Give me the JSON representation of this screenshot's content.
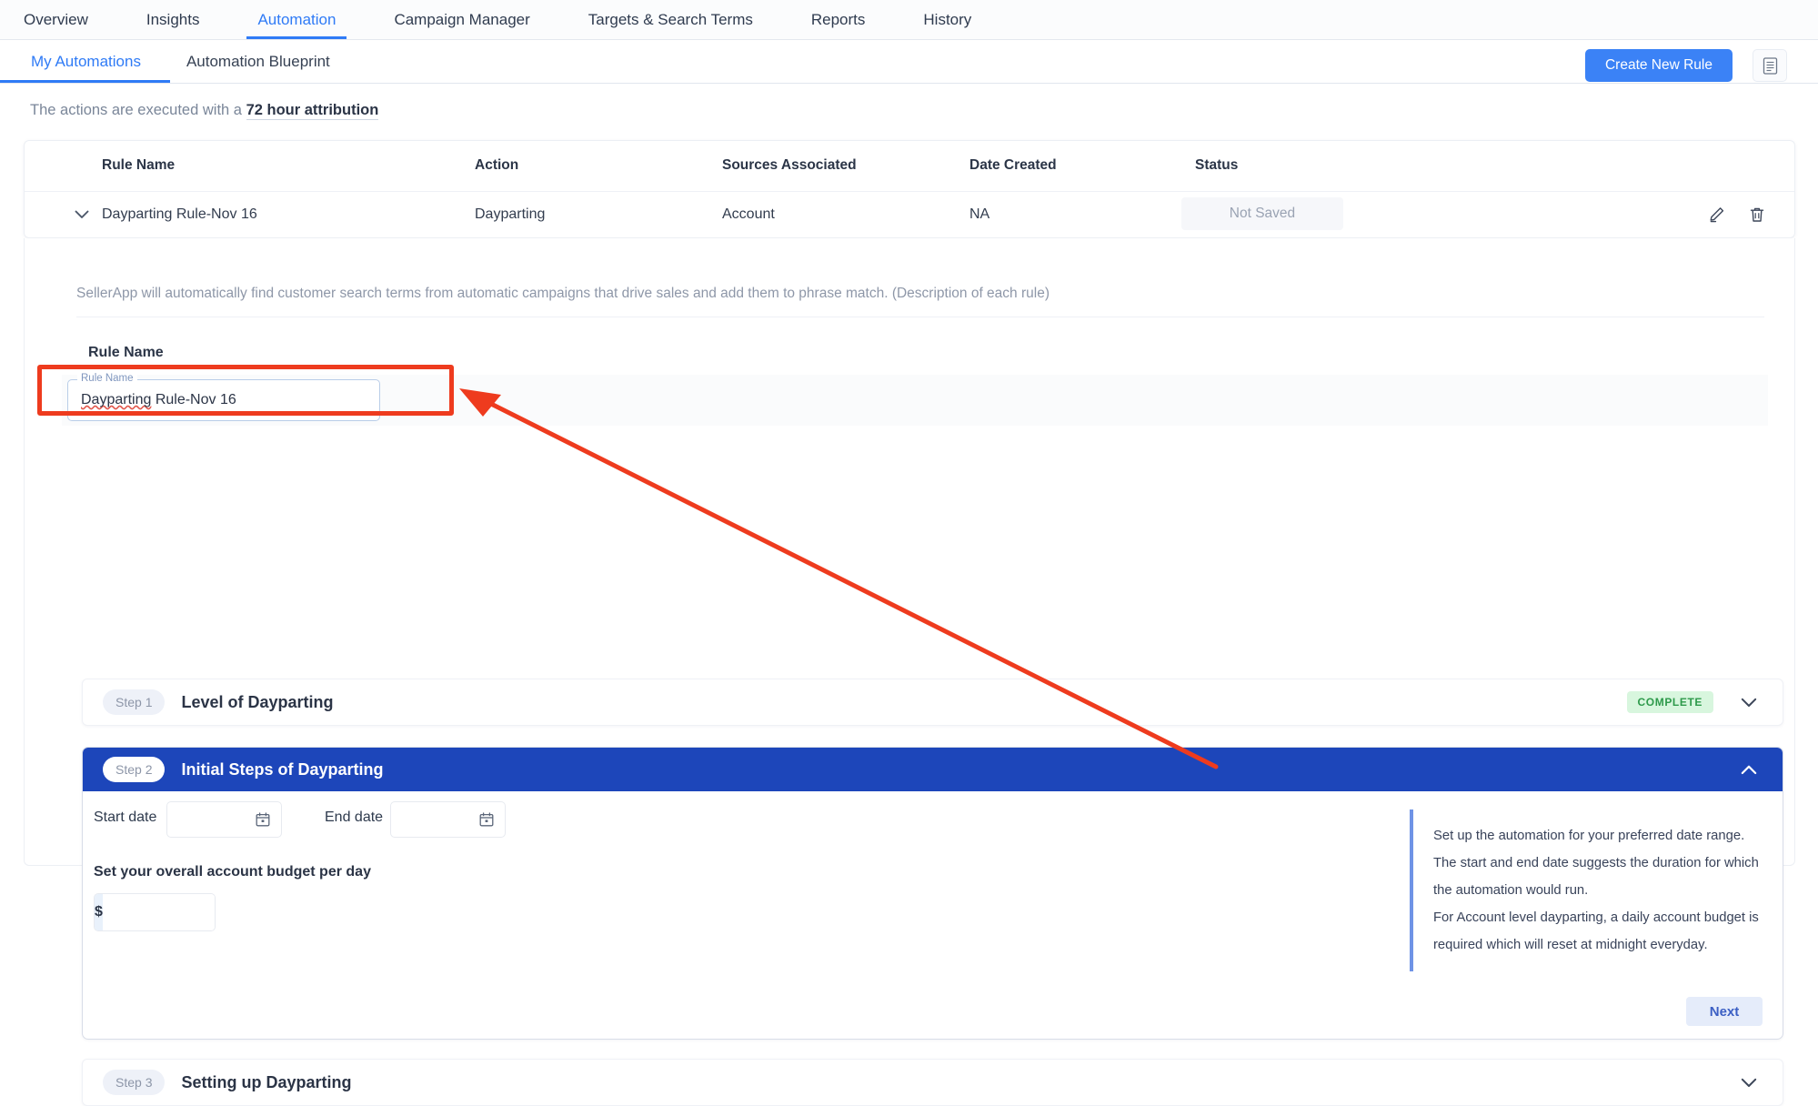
{
  "topnav": {
    "items": [
      {
        "label": "Overview",
        "active": false
      },
      {
        "label": "Insights",
        "active": false
      },
      {
        "label": "Automation",
        "active": true
      },
      {
        "label": "Campaign Manager",
        "active": false
      },
      {
        "label": "Targets & Search Terms",
        "active": false
      },
      {
        "label": "Reports",
        "active": false
      },
      {
        "label": "History",
        "active": false
      }
    ]
  },
  "subnav": {
    "items": [
      {
        "label": "My Automations",
        "active": true
      },
      {
        "label": "Automation Blueprint",
        "active": false
      }
    ],
    "create_button": "Create New Rule",
    "doc_icon": "document-icon"
  },
  "attribution": {
    "prefix": "The actions are executed with a ",
    "highlight": "72 hour attribution"
  },
  "table": {
    "headers": [
      "Rule Name",
      "Action",
      "Sources Associated",
      "Date Created",
      "Status"
    ],
    "rows": [
      {
        "rule_name": "Dayparting Rule-Nov 16",
        "action": "Dayparting",
        "sources": "Account",
        "date_created": "NA",
        "status": "Not Saved",
        "expanded": true
      }
    ]
  },
  "detail": {
    "description": "SellerApp will automatically find customer search terms from automatic campaigns that drive sales and add them to phrase match. (Description of each rule)",
    "rule_name_heading": "Rule Name",
    "rule_name_field": {
      "float_label": "Rule Name",
      "value_misspelled": "Dayparting",
      "value_rest": " Rule-Nov 16"
    }
  },
  "steps": [
    {
      "pill": "Step 1",
      "title": "Level of Dayparting",
      "badge": "COMPLETE",
      "chevron": "chevron-down-icon",
      "expanded": false
    },
    {
      "pill": "Step 2",
      "title": "Initial Steps of Dayparting",
      "chevron": "chevron-up-icon",
      "expanded": true,
      "body": {
        "start_date_label": "Start date",
        "start_date_value": "",
        "end_date_label": "End date",
        "end_date_value": "",
        "budget_label": "Set your overall account budget per day",
        "budget_prefix": "$",
        "budget_value": "",
        "info_line_1": "Set up the automation for your preferred date range. The start and end date suggests the duration for which the automation would run.",
        "info_line_2": "For Account level dayparting, a daily account budget is required which will reset at midnight everyday.",
        "next_button": "Next"
      }
    },
    {
      "pill": "Step 3",
      "title": "Setting up Dayparting",
      "chevron": "chevron-down-icon",
      "expanded": false
    }
  ],
  "annotation": {
    "color": "#ee3b1e",
    "target": "rule-name-input",
    "shape": "box-with-arrow"
  },
  "colors": {
    "accent_blue": "#2f7bf6",
    "primary_button": "#3b82f6",
    "step_active_header": "#1d46ba",
    "complete_badge_bg": "#d8f6de",
    "complete_badge_text": "#2e9a4b",
    "annotation_red": "#ee3b1e"
  }
}
